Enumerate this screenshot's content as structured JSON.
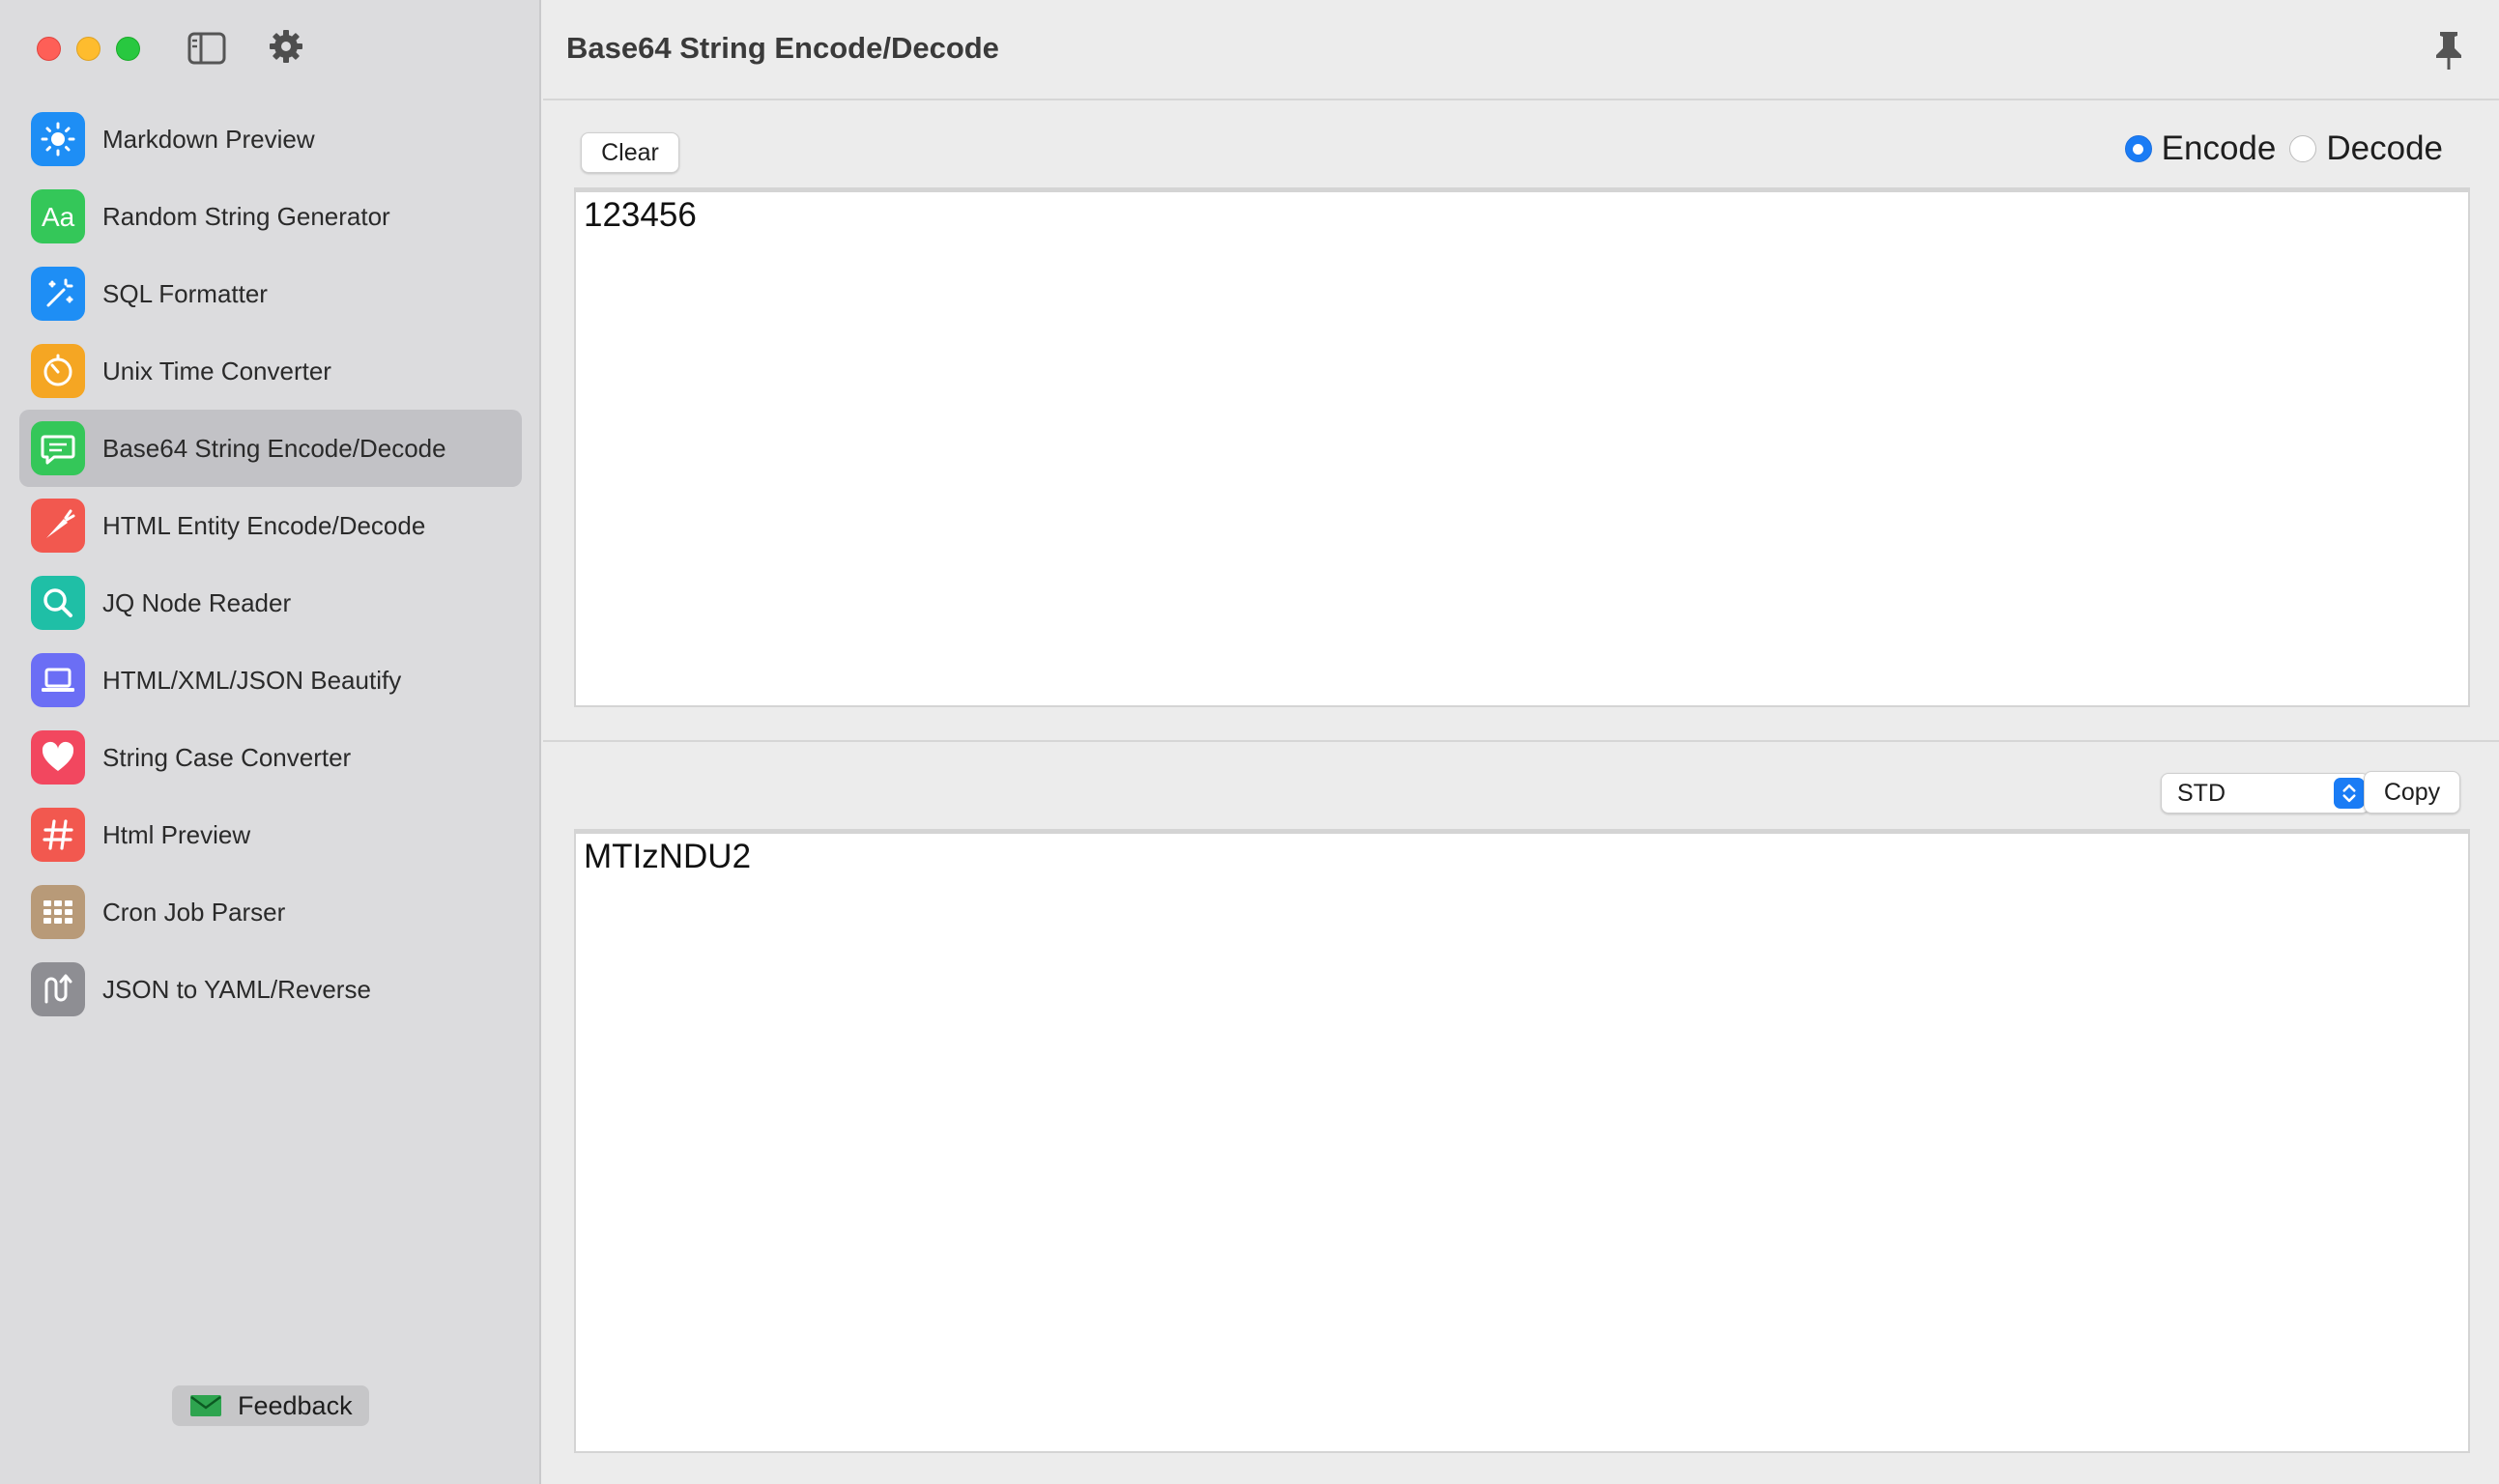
{
  "window": {
    "title": "Base64 String Encode/Decode"
  },
  "sidebar": {
    "items": [
      {
        "label": "Markdown Preview",
        "icon": "sun-icon",
        "color": "#1e8ef5"
      },
      {
        "label": "Random String Generator",
        "icon": "text-aa-icon",
        "color": "#34c759"
      },
      {
        "label": "SQL Formatter",
        "icon": "magic-wand-icon",
        "color": "#1e8ef5"
      },
      {
        "label": "Unix Time Converter",
        "icon": "timer-icon",
        "color": "#f5a623"
      },
      {
        "label": "Base64 String Encode/Decode",
        "icon": "message-bubble-icon",
        "color": "#34c759",
        "active": true
      },
      {
        "label": "HTML Entity Encode/Decode",
        "icon": "carrot-icon",
        "color": "#f2584f"
      },
      {
        "label": "JQ Node Reader",
        "icon": "magnifier-icon",
        "color": "#1fbfa6"
      },
      {
        "label": "HTML/XML/JSON Beautify",
        "icon": "laptop-icon",
        "color": "#6b6ef5"
      },
      {
        "label": "String Case Converter",
        "icon": "heart-icon",
        "color": "#f2475f"
      },
      {
        "label": "Html Preview",
        "icon": "hashtag-icon",
        "color": "#f2584f"
      },
      {
        "label": "Cron Job Parser",
        "icon": "grid-table-icon",
        "color": "#b89a78"
      },
      {
        "label": "JSON to YAML/Reverse",
        "icon": "swap-path-icon",
        "color": "#8e8e93"
      }
    ],
    "feedback_label": "Feedback"
  },
  "main": {
    "clear_label": "Clear",
    "mode": {
      "options": [
        "Encode",
        "Decode"
      ],
      "selected": "Encode"
    },
    "input_value": "123456",
    "output_value": "MTIzNDU2",
    "variant_select": "STD",
    "copy_label": "Copy"
  },
  "colors": {
    "accent": "#1a7cf5",
    "sidebar_bg": "#dcdcde",
    "active_row": "#c2c2c6"
  }
}
